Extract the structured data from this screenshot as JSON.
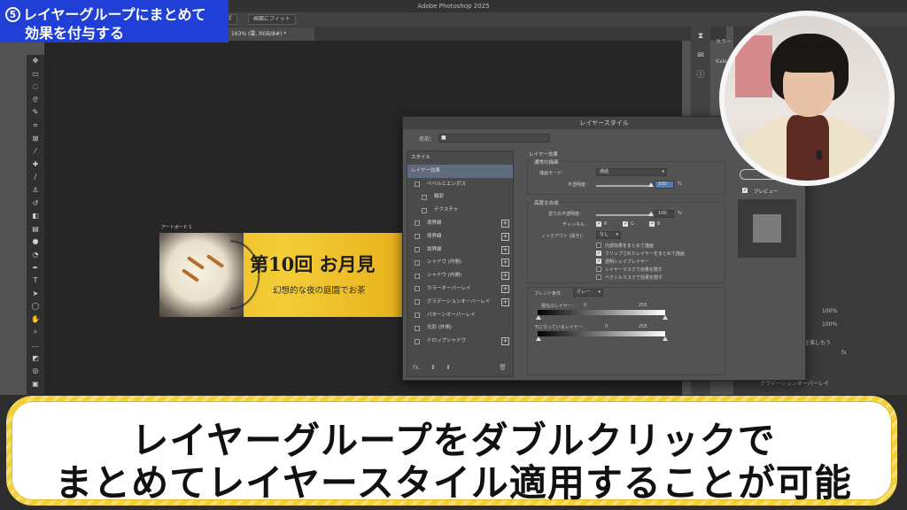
{
  "app": {
    "title": "Adobe Photoshop 2025"
  },
  "options_bar": {
    "buttons": [
      "ズ",
      "画面にフィット"
    ]
  },
  "document": {
    "tab_title": "163% (雲, RGB/8#) *"
  },
  "artboard": {
    "label": "アートボード 1",
    "banner_title": "第10回 お月見",
    "banner_subtitle": "幻想的な夜の庭園でお茶"
  },
  "dialog": {
    "title": "レイヤースタイル",
    "name_label": "名前：",
    "name_value": "■",
    "styles_header": "スタイル",
    "styles": [
      {
        "label": "レイヤー効果",
        "kind": "active"
      },
      {
        "label": "ベベルとエンボス",
        "kind": "check"
      },
      {
        "label": "輪郭",
        "kind": "sub"
      },
      {
        "label": "テクスチャ",
        "kind": "sub"
      },
      {
        "label": "境界線",
        "kind": "plus"
      },
      {
        "label": "境界線",
        "kind": "plus"
      },
      {
        "label": "境界線",
        "kind": "plus"
      },
      {
        "label": "シャドウ (内側)",
        "kind": "plus"
      },
      {
        "label": "シャドウ (内側)",
        "kind": "plus"
      },
      {
        "label": "カラーオーバーレイ",
        "kind": "plus"
      },
      {
        "label": "グラデーションオーバーレイ",
        "kind": "plus"
      },
      {
        "label": "パターンオーバーレイ",
        "kind": "check"
      },
      {
        "label": "光彩 (外側)",
        "kind": "check"
      },
      {
        "label": "ドロップシャドウ",
        "kind": "plus"
      }
    ],
    "fx_label": "fx.",
    "settings": {
      "section_title": "レイヤー効果",
      "blend_group": "通常の描画",
      "blend_mode_label": "描画モード：",
      "blend_mode_value": "通過",
      "opacity_label": "不透明度：",
      "opacity_value": "100",
      "opacity_unit": "%",
      "advanced_group": "高度な合成",
      "fill_opacity_label": "塗りの不透明度：",
      "fill_opacity_value": "100",
      "fill_opacity_unit": "%",
      "channels_label": "チャンネル：",
      "channels": [
        "R",
        "G",
        "B"
      ],
      "knockout_label": "ノックアウト (抜き)：",
      "knockout_value": "なし",
      "options": [
        {
          "label": "内部効果をまとめて描画",
          "checked": false
        },
        {
          "label": "クリップされたレイヤーをまとめて描画",
          "checked": true
        },
        {
          "label": "透明シェイプレイヤー",
          "checked": true
        },
        {
          "label": "レイヤーマスクで効果を隠す",
          "checked": false
        },
        {
          "label": "ベクトルマスクで効果を隠す",
          "checked": false
        }
      ],
      "blend_if_label": "ブレンド条件：",
      "blend_if_value": "グレー",
      "this_layer_label": "現在のレイヤー：",
      "underlying_label": "下になっているレイヤー：",
      "range_min": "0",
      "range_max": "255"
    },
    "ok_label": "新規",
    "preview_label": "プレビュー",
    "preview_checked": true
  },
  "right_panel": {
    "color_tab": "カラー",
    "kale": "Kale",
    "row1": "100%",
    "row2": "100%",
    "text1": "を楽しもう",
    "layer_label": "グラデーションオーバーレイ",
    "fx_label": "fx"
  },
  "badge": {
    "number": "5",
    "line1": "レイヤーグループにまとめて",
    "line2": "効果を付与する"
  },
  "caption": {
    "line1": "レイヤーグループをダブルクリックで",
    "line2": "まとめてレイヤースタイル適用することが可能"
  },
  "colors": {
    "badge_blue": "#1f3fd6",
    "caption_border": "#f2cf35",
    "banner_gold": "#f3cd38",
    "selection": "#5e6c7d"
  }
}
